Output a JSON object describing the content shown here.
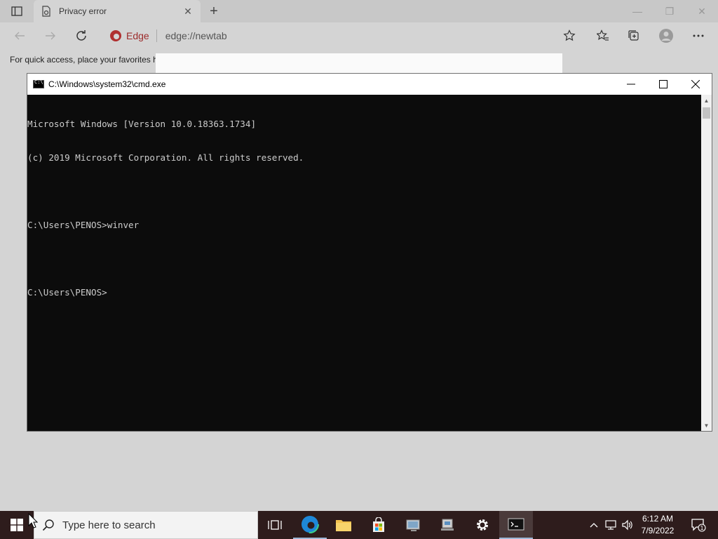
{
  "browser": {
    "tab_title": "Privacy error",
    "new_tab_symbol": "+",
    "site_label": "Edge",
    "url": "edge://newtab",
    "favorites_hint": "For quick access, place your favorites h"
  },
  "cmd": {
    "title": "C:\\Windows\\system32\\cmd.exe",
    "lines": [
      "Microsoft Windows [Version 10.0.18363.1734]",
      "(c) 2019 Microsoft Corporation. All rights reserved.",
      "",
      "C:\\Users\\PENOS>winver",
      "",
      "C:\\Users\\PENOS>"
    ]
  },
  "taskbar": {
    "search_placeholder": "Type here to search",
    "time": "6:12 AM",
    "date": "7/9/2022",
    "notification_count": "1"
  },
  "colors": {
    "console_bg": "#0c0c0c",
    "console_text": "#cccccc",
    "taskbar_bg": "#2e1c1c",
    "edge_accent": "#9c2b2b"
  }
}
